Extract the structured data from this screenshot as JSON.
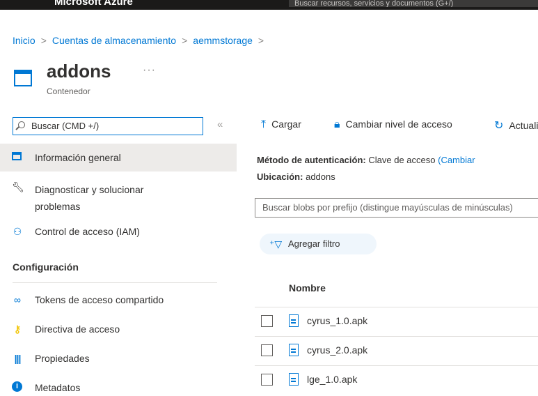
{
  "topbar": {
    "brand": "Microsoft Azure",
    "search_placeholder": "Buscar recursos, servicios y documentos (G+/)"
  },
  "breadcrumb": [
    "Inicio",
    "Cuentas de almacenamiento",
    "aemmstorage"
  ],
  "header": {
    "title": "addons",
    "more": "···",
    "subtitle": "Contenedor"
  },
  "sidebar": {
    "search_placeholder": "Buscar (CMD +/)",
    "collapse": "«",
    "items": [
      {
        "label": "Información general",
        "icon": "container-icon"
      },
      {
        "label": "Diagnosticar y solucionar problemas",
        "icon": "wrench-icon"
      },
      {
        "label": "Control de acceso (IAM)",
        "icon": "people-icon"
      }
    ],
    "section": "Configuración",
    "config_items": [
      {
        "label": "Tokens de acceso compartido",
        "icon": "link-icon"
      },
      {
        "label": "Directiva de acceso",
        "icon": "key-icon"
      },
      {
        "label": "Propiedades",
        "icon": "properties-icon"
      },
      {
        "label": "Metadatos",
        "icon": "info-icon"
      }
    ]
  },
  "toolbar": {
    "upload": "Cargar",
    "change_tier": "Cambiar nivel de acceso",
    "refresh": "Actualizar"
  },
  "details": {
    "auth_label": "Método de autenticación:",
    "auth_value": "Clave de acceso",
    "auth_link": "(Cambiar",
    "location_label": "Ubicación:",
    "location_value": "addons"
  },
  "blob_search_placeholder": "Buscar blobs por prefijo (distingue mayúsculas de minúsculas)",
  "filter_label": "Agregar filtro",
  "table": {
    "column": "Nombre",
    "rows": [
      "cyrus_1.0.apk",
      "cyrus_2.0.apk",
      "lge_1.0.apk"
    ]
  },
  "colors": {
    "accent": "#0078d4",
    "topbar": "#1b1a19",
    "active_nav": "#edebe9"
  }
}
